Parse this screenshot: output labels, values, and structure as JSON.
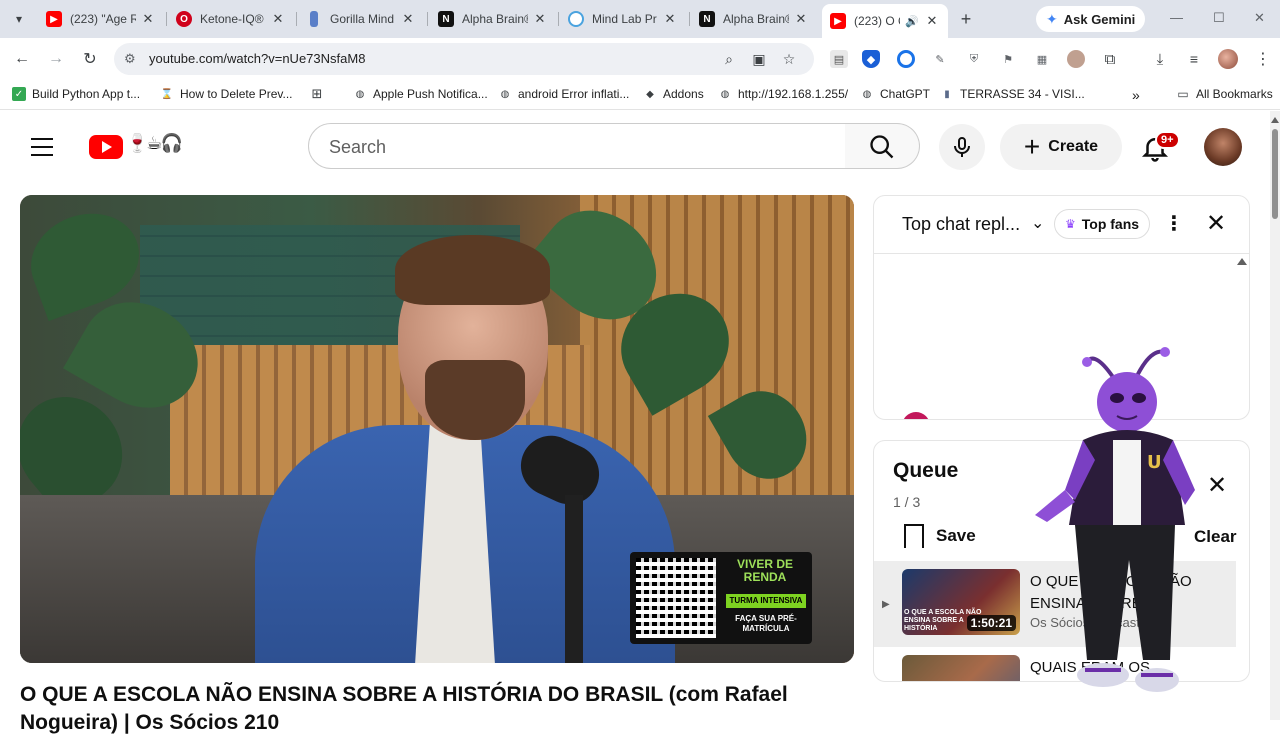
{
  "browser": {
    "tabs": [
      {
        "title": "(223) \"Age R",
        "color": "#ff0000",
        "icon": "youtube-icon"
      },
      {
        "title": "Ketone-IQ®",
        "color": "#d0021b",
        "icon": "opera-icon"
      },
      {
        "title": "Gorilla Mind",
        "color": "#5a7fc8",
        "icon": "bottle-icon"
      },
      {
        "title": "Alpha Brain®",
        "color": "#111111",
        "icon": "onnit-icon"
      },
      {
        "title": "Mind Lab Pr",
        "color": "#4aa3df",
        "icon": "mindlab-icon"
      },
      {
        "title": "Alpha Brain®",
        "color": "#111111",
        "icon": "onnit-icon"
      },
      {
        "title": "(223) O Q",
        "color": "#ff0000",
        "icon": "youtube-icon",
        "active": true
      }
    ],
    "gemini_label": "Ask Gemini",
    "url": "youtube.com/watch?v=nUe73NsfaM8",
    "bookmarks": [
      {
        "label": "Build Python App t...",
        "color": "#34a853"
      },
      {
        "label": "How to Delete Prev...",
        "color": "#f2a900"
      },
      {
        "label": "",
        "color": "#3c4043"
      },
      {
        "label": "Apple Push Notifica...",
        "color": "#3c4043"
      },
      {
        "label": "android Error inflati...",
        "color": "#3c4043"
      },
      {
        "label": "Addons",
        "color": "#3c4043"
      },
      {
        "label": "http://192.168.1.255/",
        "color": "#3c4043"
      },
      {
        "label": "ChatGPT",
        "color": "#3c4043"
      },
      {
        "label": "TERRASSE 34 - VISI...",
        "color": "#5b6b8a"
      }
    ],
    "all_bookmarks": "All Bookmarks",
    "chevron": "»"
  },
  "youtube": {
    "search_placeholder": "Search",
    "create_label": "Create",
    "notif_badge": "9+",
    "video": {
      "promo_brand": "VIVER DE RENDA",
      "promo_tag": "TURMA INTENSIVA",
      "promo_cta": "FAÇA SUA PRÉ-MATRÍCULA",
      "title_line1": "O QUE A ESCOLA NÃO ENSINA SOBRE A HISTÓRIA DO BRASIL (com Rafael",
      "title_line2": "Nogueira) | Os Sócios 210"
    },
    "chat": {
      "title": "Top chat repl...",
      "top_fans": "Top fans"
    },
    "queue": {
      "title": "Queue",
      "count": "1 / 3",
      "save_label": "Save",
      "clear_label": "Clear",
      "items": [
        {
          "title": "O QUE A ESCOLA NÃO ENSINA SOBRE...",
          "channel": "Os Sócios Podcast",
          "duration": "1:50:21",
          "thumb_text": "O QUE A ESCOLA NÃO ENSINA SOBRE A HISTÓRIA",
          "active": true
        },
        {
          "title": "QUAIS ERAM OS...",
          "channel": "",
          "duration": "",
          "thumb_text": "",
          "active": false
        }
      ]
    }
  }
}
